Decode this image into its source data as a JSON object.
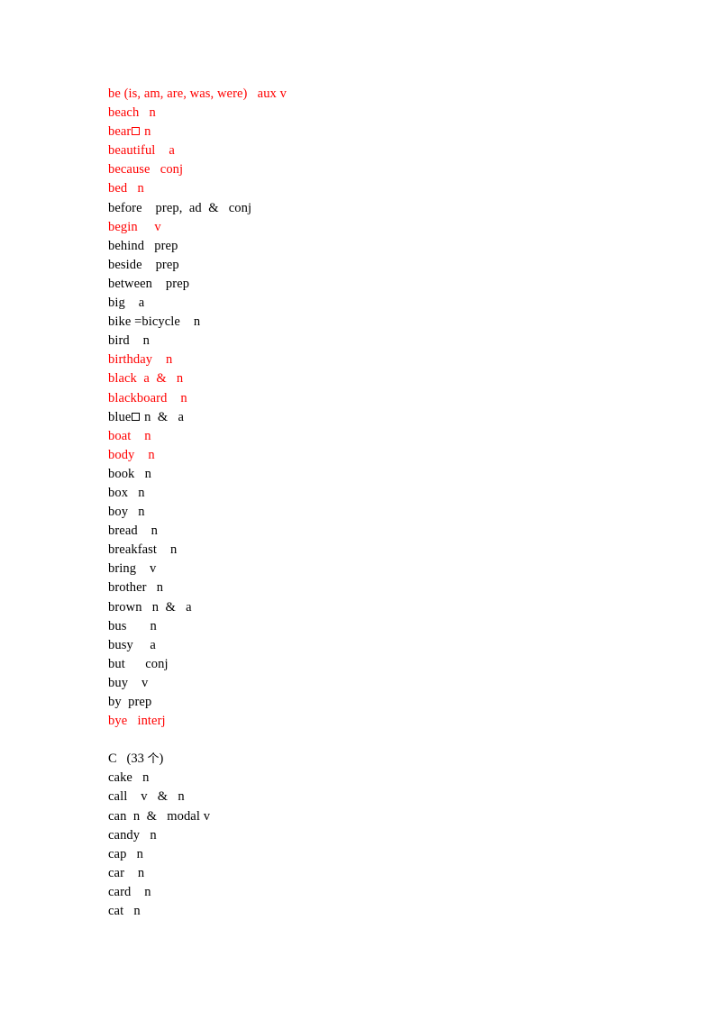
{
  "document": {
    "title": "Vocabulary Word List",
    "text_color": "#000000",
    "highlight_color": "#FF0000",
    "background_color": "#FFFFFF",
    "entries": [
      {
        "word": "be (is, am, are, was, were)",
        "pos": "aux v",
        "gap": "   ",
        "red": true
      },
      {
        "word": "beach",
        "pos": "n",
        "gap": "   ",
        "red": true
      },
      {
        "word": "bear",
        "pos": "n",
        "gap": " ",
        "red": true,
        "tofu_after_word": true
      },
      {
        "word": "beautiful",
        "pos": "a",
        "gap": "    ",
        "red": true
      },
      {
        "word": "because",
        "pos": "conj",
        "gap": "   ",
        "red": true
      },
      {
        "word": "bed",
        "pos": "n",
        "gap": "   ",
        "red": true
      },
      {
        "word": "before",
        "pos": "prep,  ad  &   conj",
        "gap": "    ",
        "red": false
      },
      {
        "word": "begin",
        "pos": "v",
        "gap": "     ",
        "red": true
      },
      {
        "word": "behind",
        "pos": "prep",
        "gap": "   ",
        "red": false
      },
      {
        "word": "beside",
        "pos": "prep",
        "gap": "    ",
        "red": false
      },
      {
        "word": "between",
        "pos": "prep",
        "gap": "    ",
        "red": false
      },
      {
        "word": "big",
        "pos": "a",
        "gap": "    ",
        "red": false
      },
      {
        "word": "bike =bicycle",
        "pos": "n",
        "gap": "    ",
        "red": false
      },
      {
        "word": "bird",
        "pos": "n",
        "gap": "    ",
        "red": false
      },
      {
        "word": "birthday",
        "pos": "n",
        "gap": "    ",
        "red": true
      },
      {
        "word": "black",
        "pos": "a  &   n",
        "gap": "  ",
        "red": true
      },
      {
        "word": "blackboard",
        "pos": "n",
        "gap": "    ",
        "red": true
      },
      {
        "word": "blue",
        "pos": "n  &   a",
        "gap": " ",
        "red": false,
        "tofu_after_word": true
      },
      {
        "word": "boat",
        "pos": "n",
        "gap": "    ",
        "red": true
      },
      {
        "word": "body",
        "pos": "n",
        "gap": "    ",
        "red": true
      },
      {
        "word": "book",
        "pos": "n",
        "gap": "   ",
        "red": false
      },
      {
        "word": "box",
        "pos": "n",
        "gap": "   ",
        "red": false
      },
      {
        "word": "boy",
        "pos": "n",
        "gap": "   ",
        "red": false
      },
      {
        "word": "bread",
        "pos": "n",
        "gap": "    ",
        "red": false
      },
      {
        "word": "breakfast",
        "pos": "n",
        "gap": "    ",
        "red": false
      },
      {
        "word": "bring",
        "pos": "v",
        "gap": "    ",
        "red": false
      },
      {
        "word": "brother",
        "pos": "n",
        "gap": "   ",
        "red": false
      },
      {
        "word": "brown",
        "pos": "n  &   a",
        "gap": "   ",
        "red": false
      },
      {
        "word": "bus",
        "pos": "n",
        "gap": "       ",
        "red": false
      },
      {
        "word": "busy",
        "pos": "a",
        "gap": "     ",
        "red": false
      },
      {
        "word": "but",
        "pos": "conj",
        "gap": "      ",
        "red": false
      },
      {
        "word": "buy",
        "pos": "v",
        "gap": "    ",
        "red": false
      },
      {
        "word": "by",
        "pos": "prep",
        "gap": "  ",
        "red": false
      },
      {
        "word": "bye",
        "pos": "interj",
        "gap": "   ",
        "red": true
      },
      {
        "blank": true
      },
      {
        "section_head": true,
        "letter": "C",
        "count_text": "(33 ",
        "cjk": "个",
        "count_close": ")",
        "gap": "   "
      },
      {
        "word": "cake",
        "pos": "n",
        "gap": "   ",
        "red": false
      },
      {
        "word": "call",
        "pos": "v   &   n",
        "gap": "    ",
        "red": false
      },
      {
        "word": "can",
        "pos": "n  &   modal v",
        "gap": "  ",
        "red": false
      },
      {
        "word": "candy",
        "pos": "n",
        "gap": "   ",
        "red": false
      },
      {
        "word": "cap",
        "pos": "n",
        "gap": "   ",
        "red": false
      },
      {
        "word": "car",
        "pos": "n",
        "gap": "    ",
        "red": false
      },
      {
        "word": "card",
        "pos": "n",
        "gap": "    ",
        "red": false
      },
      {
        "word": "cat",
        "pos": "n",
        "gap": "   ",
        "red": false
      }
    ]
  }
}
